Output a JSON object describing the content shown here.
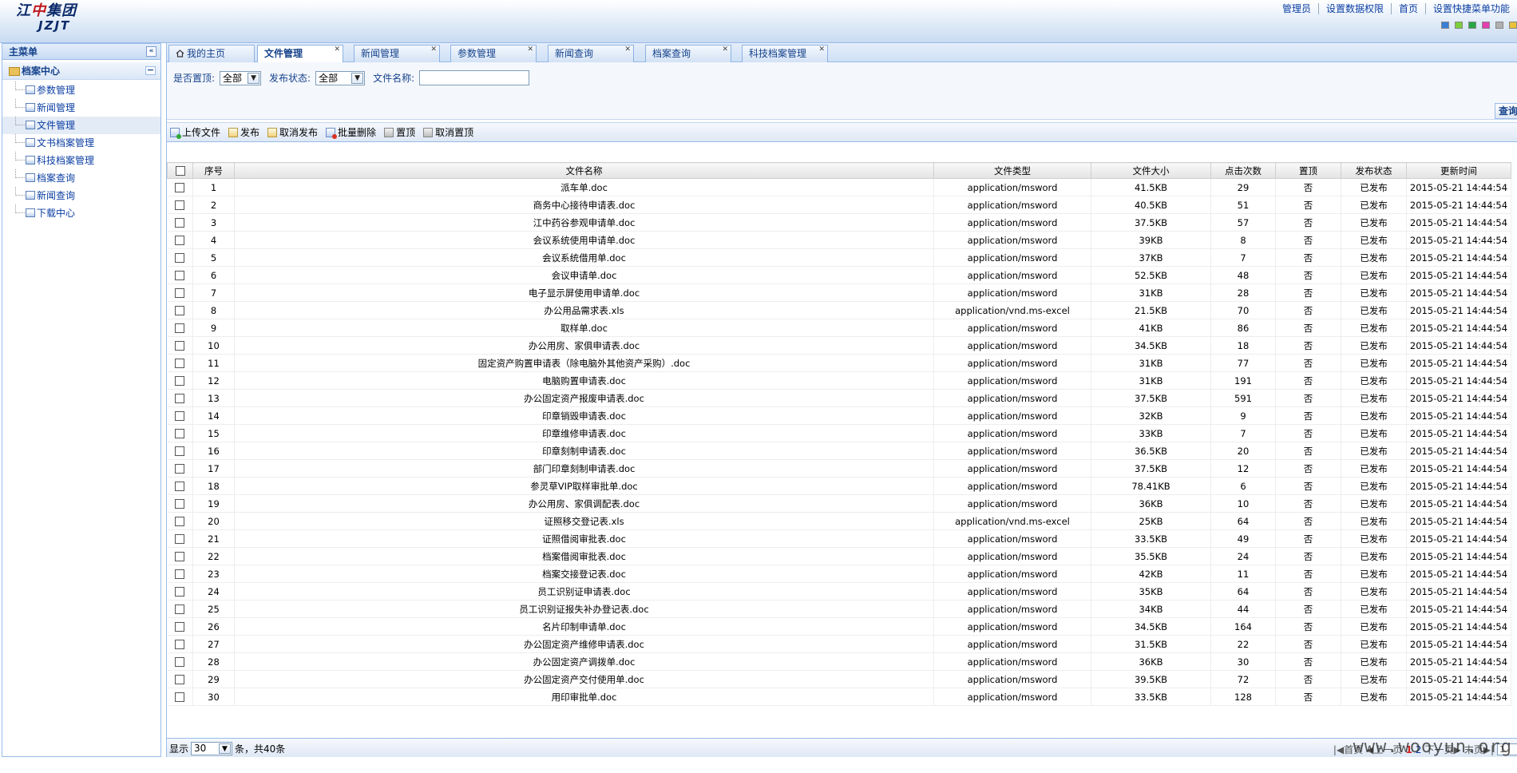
{
  "header": {
    "logo_cn_a": "江",
    "logo_cn_b": "中",
    "logo_cn_c": "集团",
    "logo_en": "JZJT",
    "links": [
      "管理员",
      "设置数据权限",
      "首页",
      "设置快捷菜单功能"
    ],
    "skin_colors": [
      "#3a7fd5",
      "#7ccf3a",
      "#29a745",
      "#e33fb0",
      "#b0b0b0",
      "#e8c23a"
    ]
  },
  "sidebar": {
    "title": "主菜单",
    "collapse_glyph": "«",
    "group": "档案中心",
    "items": [
      "参数管理",
      "新闻管理",
      "文件管理",
      "文书档案管理",
      "科技档案管理",
      "档案查询",
      "新闻查询",
      "下载中心"
    ]
  },
  "tabs": [
    {
      "label": "我的主页"
    },
    {
      "label": "文件管理"
    },
    {
      "label": "新闻管理"
    },
    {
      "label": "参数管理"
    },
    {
      "label": "新闻查询"
    },
    {
      "label": "档案查询"
    },
    {
      "label": "科技档案管理"
    }
  ],
  "filter": {
    "top_label": "是否置顶:",
    "top_value": "全部",
    "status_label": "发布状态:",
    "status_value": "全部",
    "name_label": "文件名称:",
    "name_value": "",
    "query_label": "查询"
  },
  "toolbar": {
    "upload": "上传文件",
    "publish": "发布",
    "unpublish": "取消发布",
    "batch_delete": "批量删除",
    "set_top": "置顶",
    "cancel_top": "取消置顶"
  },
  "table": {
    "headers": [
      "序号",
      "文件名称",
      "文件类型",
      "文件大小",
      "点击次数",
      "置顶",
      "发布状态",
      "更新时间"
    ],
    "rows": [
      [
        "1",
        "派车单.doc",
        "application/msword",
        "41.5KB",
        "29",
        "否",
        "已发布",
        "2015-05-21 14:44:54"
      ],
      [
        "2",
        "商务中心接待申请表.doc",
        "application/msword",
        "40.5KB",
        "51",
        "否",
        "已发布",
        "2015-05-21 14:44:54"
      ],
      [
        "3",
        "江中药谷参观申请单.doc",
        "application/msword",
        "37.5KB",
        "57",
        "否",
        "已发布",
        "2015-05-21 14:44:54"
      ],
      [
        "4",
        "会议系统使用申请单.doc",
        "application/msword",
        "39KB",
        "8",
        "否",
        "已发布",
        "2015-05-21 14:44:54"
      ],
      [
        "5",
        "会议系统借用单.doc",
        "application/msword",
        "37KB",
        "7",
        "否",
        "已发布",
        "2015-05-21 14:44:54"
      ],
      [
        "6",
        "会议申请单.doc",
        "application/msword",
        "52.5KB",
        "48",
        "否",
        "已发布",
        "2015-05-21 14:44:54"
      ],
      [
        "7",
        "电子显示屏使用申请单.doc",
        "application/msword",
        "31KB",
        "28",
        "否",
        "已发布",
        "2015-05-21 14:44:54"
      ],
      [
        "8",
        "办公用品需求表.xls",
        "application/vnd.ms-excel",
        "21.5KB",
        "70",
        "否",
        "已发布",
        "2015-05-21 14:44:54"
      ],
      [
        "9",
        "取样单.doc",
        "application/msword",
        "41KB",
        "86",
        "否",
        "已发布",
        "2015-05-21 14:44:54"
      ],
      [
        "10",
        "办公用房、家俱申请表.doc",
        "application/msword",
        "34.5KB",
        "18",
        "否",
        "已发布",
        "2015-05-21 14:44:54"
      ],
      [
        "11",
        "固定资产购置申请表（除电脑外其他资产采购）.doc",
        "application/msword",
        "31KB",
        "77",
        "否",
        "已发布",
        "2015-05-21 14:44:54"
      ],
      [
        "12",
        "电脑购置申请表.doc",
        "application/msword",
        "31KB",
        "191",
        "否",
        "已发布",
        "2015-05-21 14:44:54"
      ],
      [
        "13",
        "办公固定资产报废申请表.doc",
        "application/msword",
        "37.5KB",
        "591",
        "否",
        "已发布",
        "2015-05-21 14:44:54"
      ],
      [
        "14",
        "印章销毁申请表.doc",
        "application/msword",
        "32KB",
        "9",
        "否",
        "已发布",
        "2015-05-21 14:44:54"
      ],
      [
        "15",
        "印章维修申请表.doc",
        "application/msword",
        "33KB",
        "7",
        "否",
        "已发布",
        "2015-05-21 14:44:54"
      ],
      [
        "16",
        "印章刻制申请表.doc",
        "application/msword",
        "36.5KB",
        "20",
        "否",
        "已发布",
        "2015-05-21 14:44:54"
      ],
      [
        "17",
        "部门印章刻制申请表.doc",
        "application/msword",
        "37.5KB",
        "12",
        "否",
        "已发布",
        "2015-05-21 14:44:54"
      ],
      [
        "18",
        "参灵草VIP取样审批单.doc",
        "application/msword",
        "78.41KB",
        "6",
        "否",
        "已发布",
        "2015-05-21 14:44:54"
      ],
      [
        "19",
        "办公用房、家俱调配表.doc",
        "application/msword",
        "36KB",
        "10",
        "否",
        "已发布",
        "2015-05-21 14:44:54"
      ],
      [
        "20",
        "证照移交登记表.xls",
        "application/vnd.ms-excel",
        "25KB",
        "64",
        "否",
        "已发布",
        "2015-05-21 14:44:54"
      ],
      [
        "21",
        "证照借阅审批表.doc",
        "application/msword",
        "33.5KB",
        "49",
        "否",
        "已发布",
        "2015-05-21 14:44:54"
      ],
      [
        "22",
        "档案借阅审批表.doc",
        "application/msword",
        "35.5KB",
        "24",
        "否",
        "已发布",
        "2015-05-21 14:44:54"
      ],
      [
        "23",
        "档案交接登记表.doc",
        "application/msword",
        "42KB",
        "11",
        "否",
        "已发布",
        "2015-05-21 14:44:54"
      ],
      [
        "24",
        "员工识别证申请表.doc",
        "application/msword",
        "35KB",
        "64",
        "否",
        "已发布",
        "2015-05-21 14:44:54"
      ],
      [
        "25",
        "员工识别证报失补办登记表.doc",
        "application/msword",
        "34KB",
        "44",
        "否",
        "已发布",
        "2015-05-21 14:44:54"
      ],
      [
        "26",
        "名片印制申请单.doc",
        "application/msword",
        "34.5KB",
        "164",
        "否",
        "已发布",
        "2015-05-21 14:44:54"
      ],
      [
        "27",
        "办公固定资产维修申请表.doc",
        "application/msword",
        "31.5KB",
        "22",
        "否",
        "已发布",
        "2015-05-21 14:44:54"
      ],
      [
        "28",
        "办公固定资产调拨单.doc",
        "application/msword",
        "36KB",
        "30",
        "否",
        "已发布",
        "2015-05-21 14:44:54"
      ],
      [
        "29",
        "办公固定资产交付使用单.doc",
        "application/msword",
        "39.5KB",
        "72",
        "否",
        "已发布",
        "2015-05-21 14:44:54"
      ],
      [
        "30",
        "用印审批单.doc",
        "application/msword",
        "33.5KB",
        "128",
        "否",
        "已发布",
        "2015-05-21 14:44:54"
      ]
    ]
  },
  "pager": {
    "show_label": "显示",
    "page_size": "30",
    "summary": "条，共40条",
    "first": "首页",
    "prev": "上一页",
    "pages": [
      "1",
      "2"
    ],
    "next": "下一页",
    "last": "末页",
    "page_input": "1",
    "watermark": "www.wooyun.org"
  }
}
